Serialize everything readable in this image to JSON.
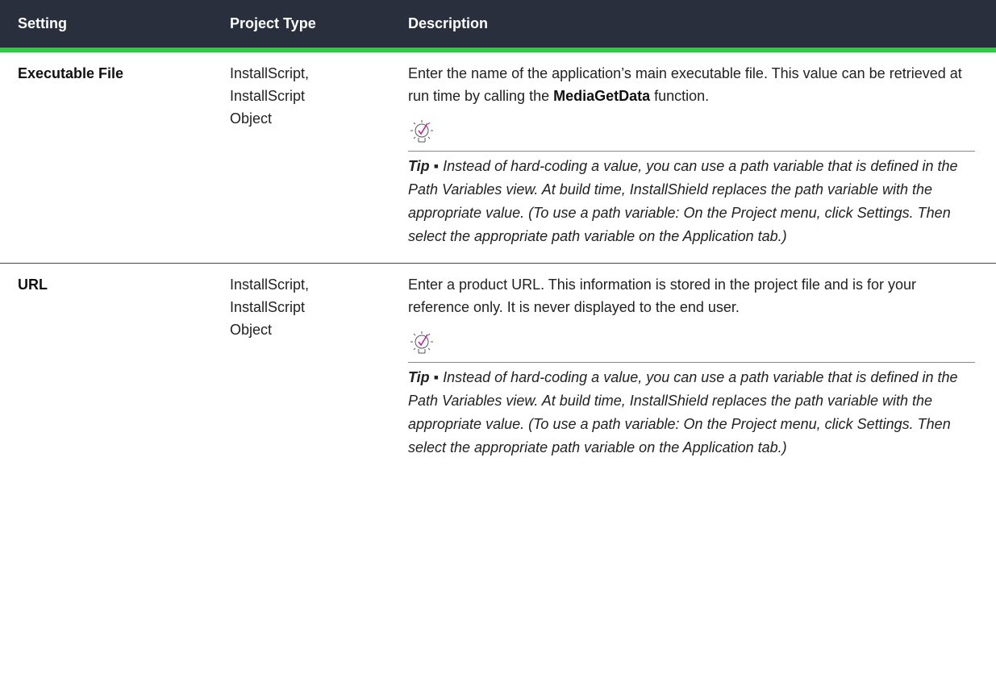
{
  "header": {
    "setting": "Setting",
    "project_type": "Project Type",
    "description": "Description"
  },
  "rows": [
    {
      "setting": "Executable File",
      "project_type_line1": "InstallScript,",
      "project_type_line2": "InstallScript",
      "project_type_line3": "Object",
      "desc_part1": "Enter the name of the application’s main executable file. This value can be retrieved at run time by calling the ",
      "desc_bold": "MediaGetData",
      "desc_part2": " function.",
      "tip_label": "Tip ▪",
      "tip_text": " Instead of hard-coding a value, you can use a path variable that is defined in the Path Variables view. At build time, InstallShield replaces the path variable with the appropriate value. (To use a path variable: On the Project menu, click Settings. Then select the appropriate path variable on the Application tab.)"
    },
    {
      "setting": "URL",
      "project_type_line1": "InstallScript,",
      "project_type_line2": "InstallScript",
      "project_type_line3": "Object",
      "desc_part1": "Enter a product URL. This information is stored in the project file and is for your reference only. It is never displayed to the end user.",
      "tip_label": "Tip ▪",
      "tip_text": " Instead of hard-coding a value, you can use a path variable that is defined in the Path Variables view. At build time, InstallShield replaces the path variable with the appropriate value. (To use a path variable: On the Project menu, click Settings. Then select the appropriate path variable on the Application tab.)"
    }
  ],
  "icons": {
    "tip": "lightbulb-check-icon",
    "tip_accent": "#c0229a"
  }
}
